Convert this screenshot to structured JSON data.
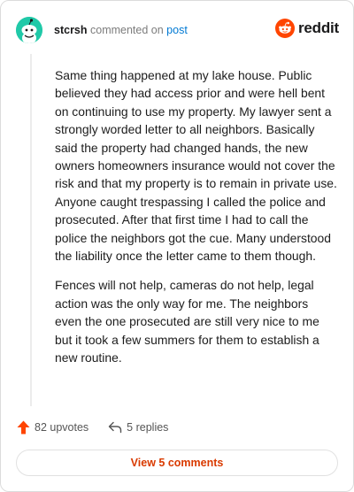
{
  "comment": {
    "username": "stcrsh",
    "action_text": " commented on ",
    "target_link": "post",
    "paragraphs": [
      "Same thing happened at my lake house. Public believed they had access prior and were hell bent on continuing to use my property. My lawyer sent a strongly worded letter to all neighbors. Basically said the property had changed hands, the new owners homeowners insurance would not cover the risk and that my property is to remain in private use. Anyone caught trespassing I called the police and prosecuted. After that first time I had to call the police the neighbors got the cue. Many understood the liability once the letter came to them though.",
      "Fences will not help, cameras do not help, legal action was the only way for me. The neighbors even the one prosecuted are still very nice to me but it took a few summers for them to establish a new routine."
    ],
    "upvotes_label": "82 upvotes",
    "replies_label": "5 replies",
    "view_comments_label": "View 5 comments"
  },
  "brand": {
    "logo_text": "reddit",
    "accent_color": "#ff4500"
  },
  "icons": {
    "avatar": "snoo-avatar-icon",
    "upvote": "upvote-arrow-icon",
    "reply": "reply-arrow-icon",
    "logo": "reddit-logo-icon"
  },
  "colors": {
    "link": "#0079d3",
    "view_comments": "#d93a00",
    "avatar_bg": "#20c9a8"
  }
}
